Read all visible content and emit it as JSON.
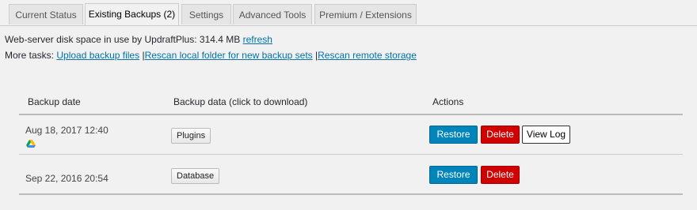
{
  "tabs": [
    {
      "label": "Current Status"
    },
    {
      "label": "Existing Backups (2)"
    },
    {
      "label": "Settings"
    },
    {
      "label": "Advanced Tools"
    },
    {
      "label": "Premium / Extensions"
    }
  ],
  "disk": {
    "prefix": "Web-server disk space in use by UpdraftPlus:",
    "value": "314.4 MB",
    "refresh_label": "refresh"
  },
  "tasks": {
    "prefix": "More tasks:",
    "upload_label": "Upload backup files",
    "rescan_local_label": "Rescan local folder for new backup sets",
    "rescan_remote_label": "Rescan remote storage",
    "separator": "|"
  },
  "table": {
    "headers": {
      "date": "Backup date",
      "data": "Backup data (click to download)",
      "actions": "Actions"
    },
    "rows": [
      {
        "date": "Aug 18, 2017 12:40",
        "storage_icon": "google-drive-icon",
        "data_button": "Plugins",
        "restore": "Restore",
        "delete": "Delete",
        "view_log": "View Log"
      },
      {
        "date": "Sep 22, 2016 20:54",
        "data_button": "Database",
        "restore": "Restore",
        "delete": "Delete"
      }
    ]
  },
  "colors": {
    "restore": "#0085ba",
    "delete": "#d00000",
    "link": "#0073aa"
  }
}
